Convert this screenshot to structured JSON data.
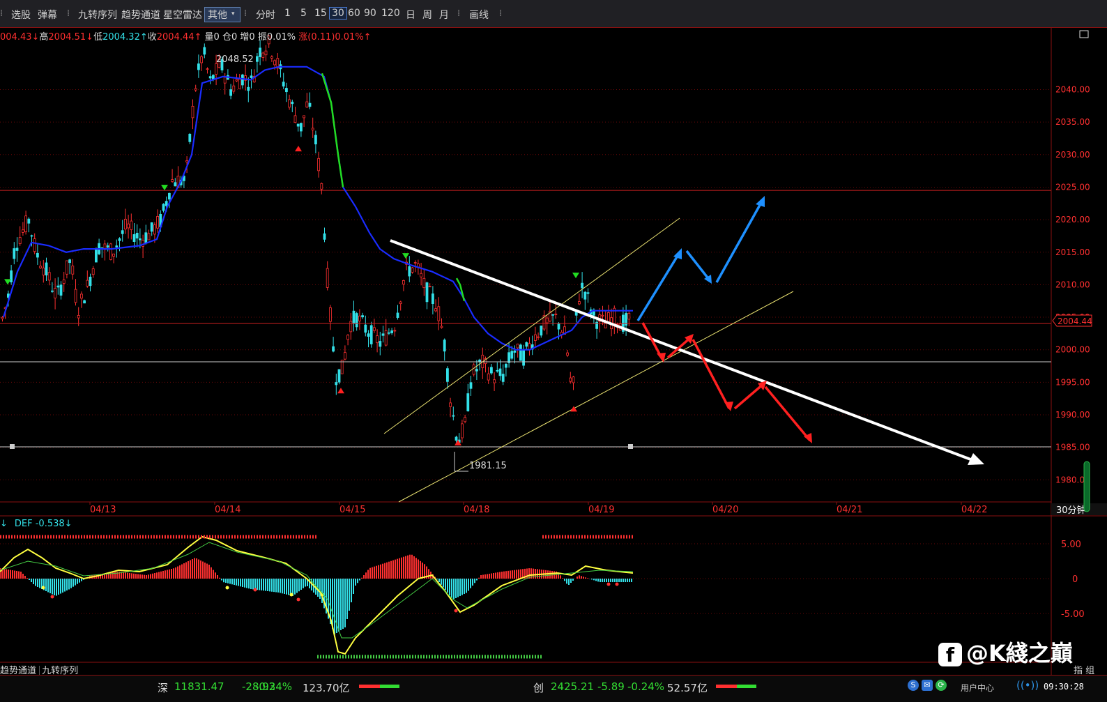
{
  "toolbar": {
    "items": [
      "选股",
      "弹幕",
      "九转序列",
      "趋势通道",
      "星空雷达",
      "其他",
      "分时",
      "1",
      "5",
      "15",
      "30",
      "60",
      "90",
      "120",
      "日",
      "周",
      "月",
      "画线"
    ],
    "selected_period": "30"
  },
  "quote": {
    "open": "004.43↓",
    "high_label": "高",
    "high": "2004.51↓",
    "low_label": "低",
    "low": "2004.32↑",
    "close_label": "收",
    "close": "2004.44↑",
    "vol": "量0",
    "pos": "仓0",
    "inc": "增0",
    "amp_label": "振",
    "amp": "0.01%",
    "chg_label": "涨",
    "chg": "(0.11)0.01%↑"
  },
  "price_axis": {
    "ticks": [
      "2040.00",
      "2035.00",
      "2030.00",
      "2025.00",
      "2020.00",
      "2015.00",
      "2010.00",
      "2005.00",
      "2000.00",
      "1995.00",
      "1990.00",
      "1985.00",
      "1980.00"
    ],
    "current": "2004.44",
    "period_label": "30分钟"
  },
  "date_axis": [
    "04/13",
    "04/14",
    "04/15",
    "04/18",
    "04/19",
    "04/20",
    "04/21",
    "04/22"
  ],
  "annotations": {
    "high": "2048.52",
    "low": "1981.15"
  },
  "indicator": {
    "label_prefix": "↓",
    "label": "DEF -0.538↓",
    "ticks": [
      "5.00",
      "0",
      "-5.00"
    ]
  },
  "bottom_tabs": [
    "趋势通道",
    "九转序列"
  ],
  "right_tabs": "指 组",
  "status": {
    "sz_label": "深",
    "sz_index": "11831.47",
    "sz_chg": "-28.93",
    "sz_pct": "-0.24%",
    "sz_amt": "123.70亿",
    "cy_label": "创",
    "cy_index": "2425.21",
    "cy_chg": "-5.89",
    "cy_pct": "-0.24%",
    "cy_amt": "52.57亿",
    "user_center": "用户中心",
    "time": "09:30:28"
  },
  "watermark": "@K綫之巔",
  "colors": {
    "up": "#ff3030",
    "down": "#33e0e8",
    "ma": "#1a2cff",
    "ma_green": "#22dd22",
    "grid": "#7a0a0a",
    "blue_arrow": "#1e90ff",
    "red_arrow": "#ff2020",
    "yellow": "#ffff40"
  }
}
